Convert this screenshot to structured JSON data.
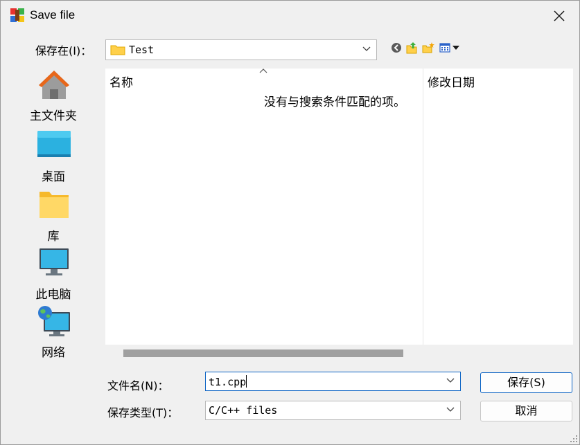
{
  "window": {
    "title": "Save file"
  },
  "look_in": {
    "label": "保存在(I)：",
    "value": "Test"
  },
  "toolbar": {
    "icons": [
      "back-icon",
      "up-folder-icon",
      "new-folder-icon",
      "view-menu-icon"
    ]
  },
  "places": [
    {
      "label": "主文件夹",
      "icon": "home-icon"
    },
    {
      "label": "桌面",
      "icon": "desktop-icon"
    },
    {
      "label": "库",
      "icon": "folder-icon"
    },
    {
      "label": "此电脑",
      "icon": "computer-icon"
    },
    {
      "label": "网络",
      "icon": "network-icon"
    }
  ],
  "file_list": {
    "columns": [
      "名称",
      "修改日期"
    ],
    "empty_message": "没有与搜索条件匹配的项。"
  },
  "filename": {
    "label": "文件名(N)：",
    "value": "t1.cpp"
  },
  "filetype": {
    "label": "保存类型(T)：",
    "value": "C/C++ files"
  },
  "buttons": {
    "save": "保存(S)",
    "cancel": "取消"
  },
  "colors": {
    "accent": "#0b63c4",
    "folder": "#ffd04a",
    "scroll_thumb": "#a0a0a0"
  }
}
